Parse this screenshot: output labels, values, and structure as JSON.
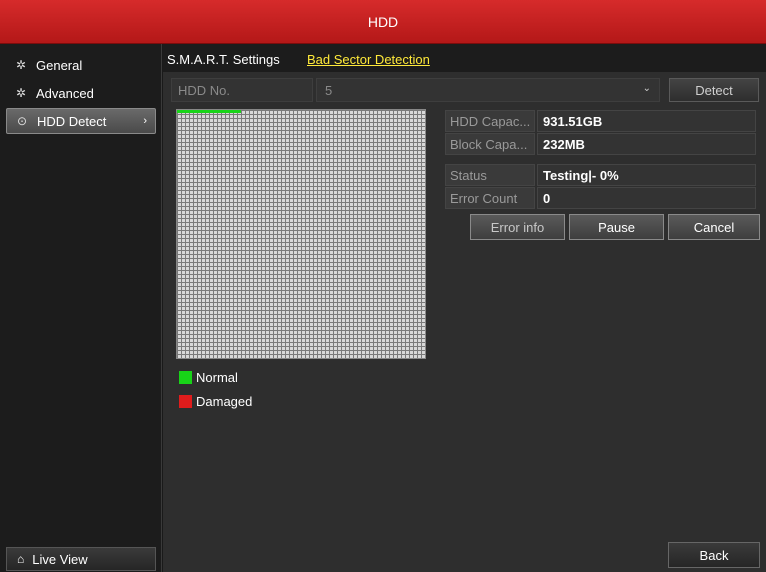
{
  "title": "HDD",
  "sidebar": {
    "items": [
      {
        "label": "General",
        "icon": "gear-icon",
        "glyph": "✲"
      },
      {
        "label": "Advanced",
        "icon": "gears-icon",
        "glyph": "✲"
      },
      {
        "label": "HDD Detect",
        "icon": "check-shield-icon",
        "glyph": "⊙",
        "chevron": "›"
      }
    ],
    "live_view": {
      "label": "Live View",
      "icon": "home-icon",
      "glyph": "⌂"
    }
  },
  "tabs": [
    {
      "label": "S.M.A.R.T. Settings",
      "active": false
    },
    {
      "label": "Bad Sector Detection",
      "active": true
    }
  ],
  "hdd_no": {
    "label": "HDD No.",
    "value": "5",
    "caret": "⌄"
  },
  "detect_label": "Detect",
  "scan": {
    "progress_fraction": 0.26
  },
  "legend": [
    {
      "label": "Normal",
      "color": "#18d318"
    },
    {
      "label": "Damaged",
      "color": "#e01c1c"
    }
  ],
  "info": {
    "hdd_capacity": {
      "label": "HDD Capac...",
      "value": "931.51GB"
    },
    "block_capacity": {
      "label": "Block Capa...",
      "value": "232MB"
    },
    "status": {
      "label": "Status",
      "value": "Testing|- 0%"
    },
    "error_count": {
      "label": "Error Count",
      "value": "0"
    }
  },
  "buttons": {
    "error_info": "Error info",
    "pause": "Pause",
    "cancel": "Cancel",
    "back": "Back"
  }
}
